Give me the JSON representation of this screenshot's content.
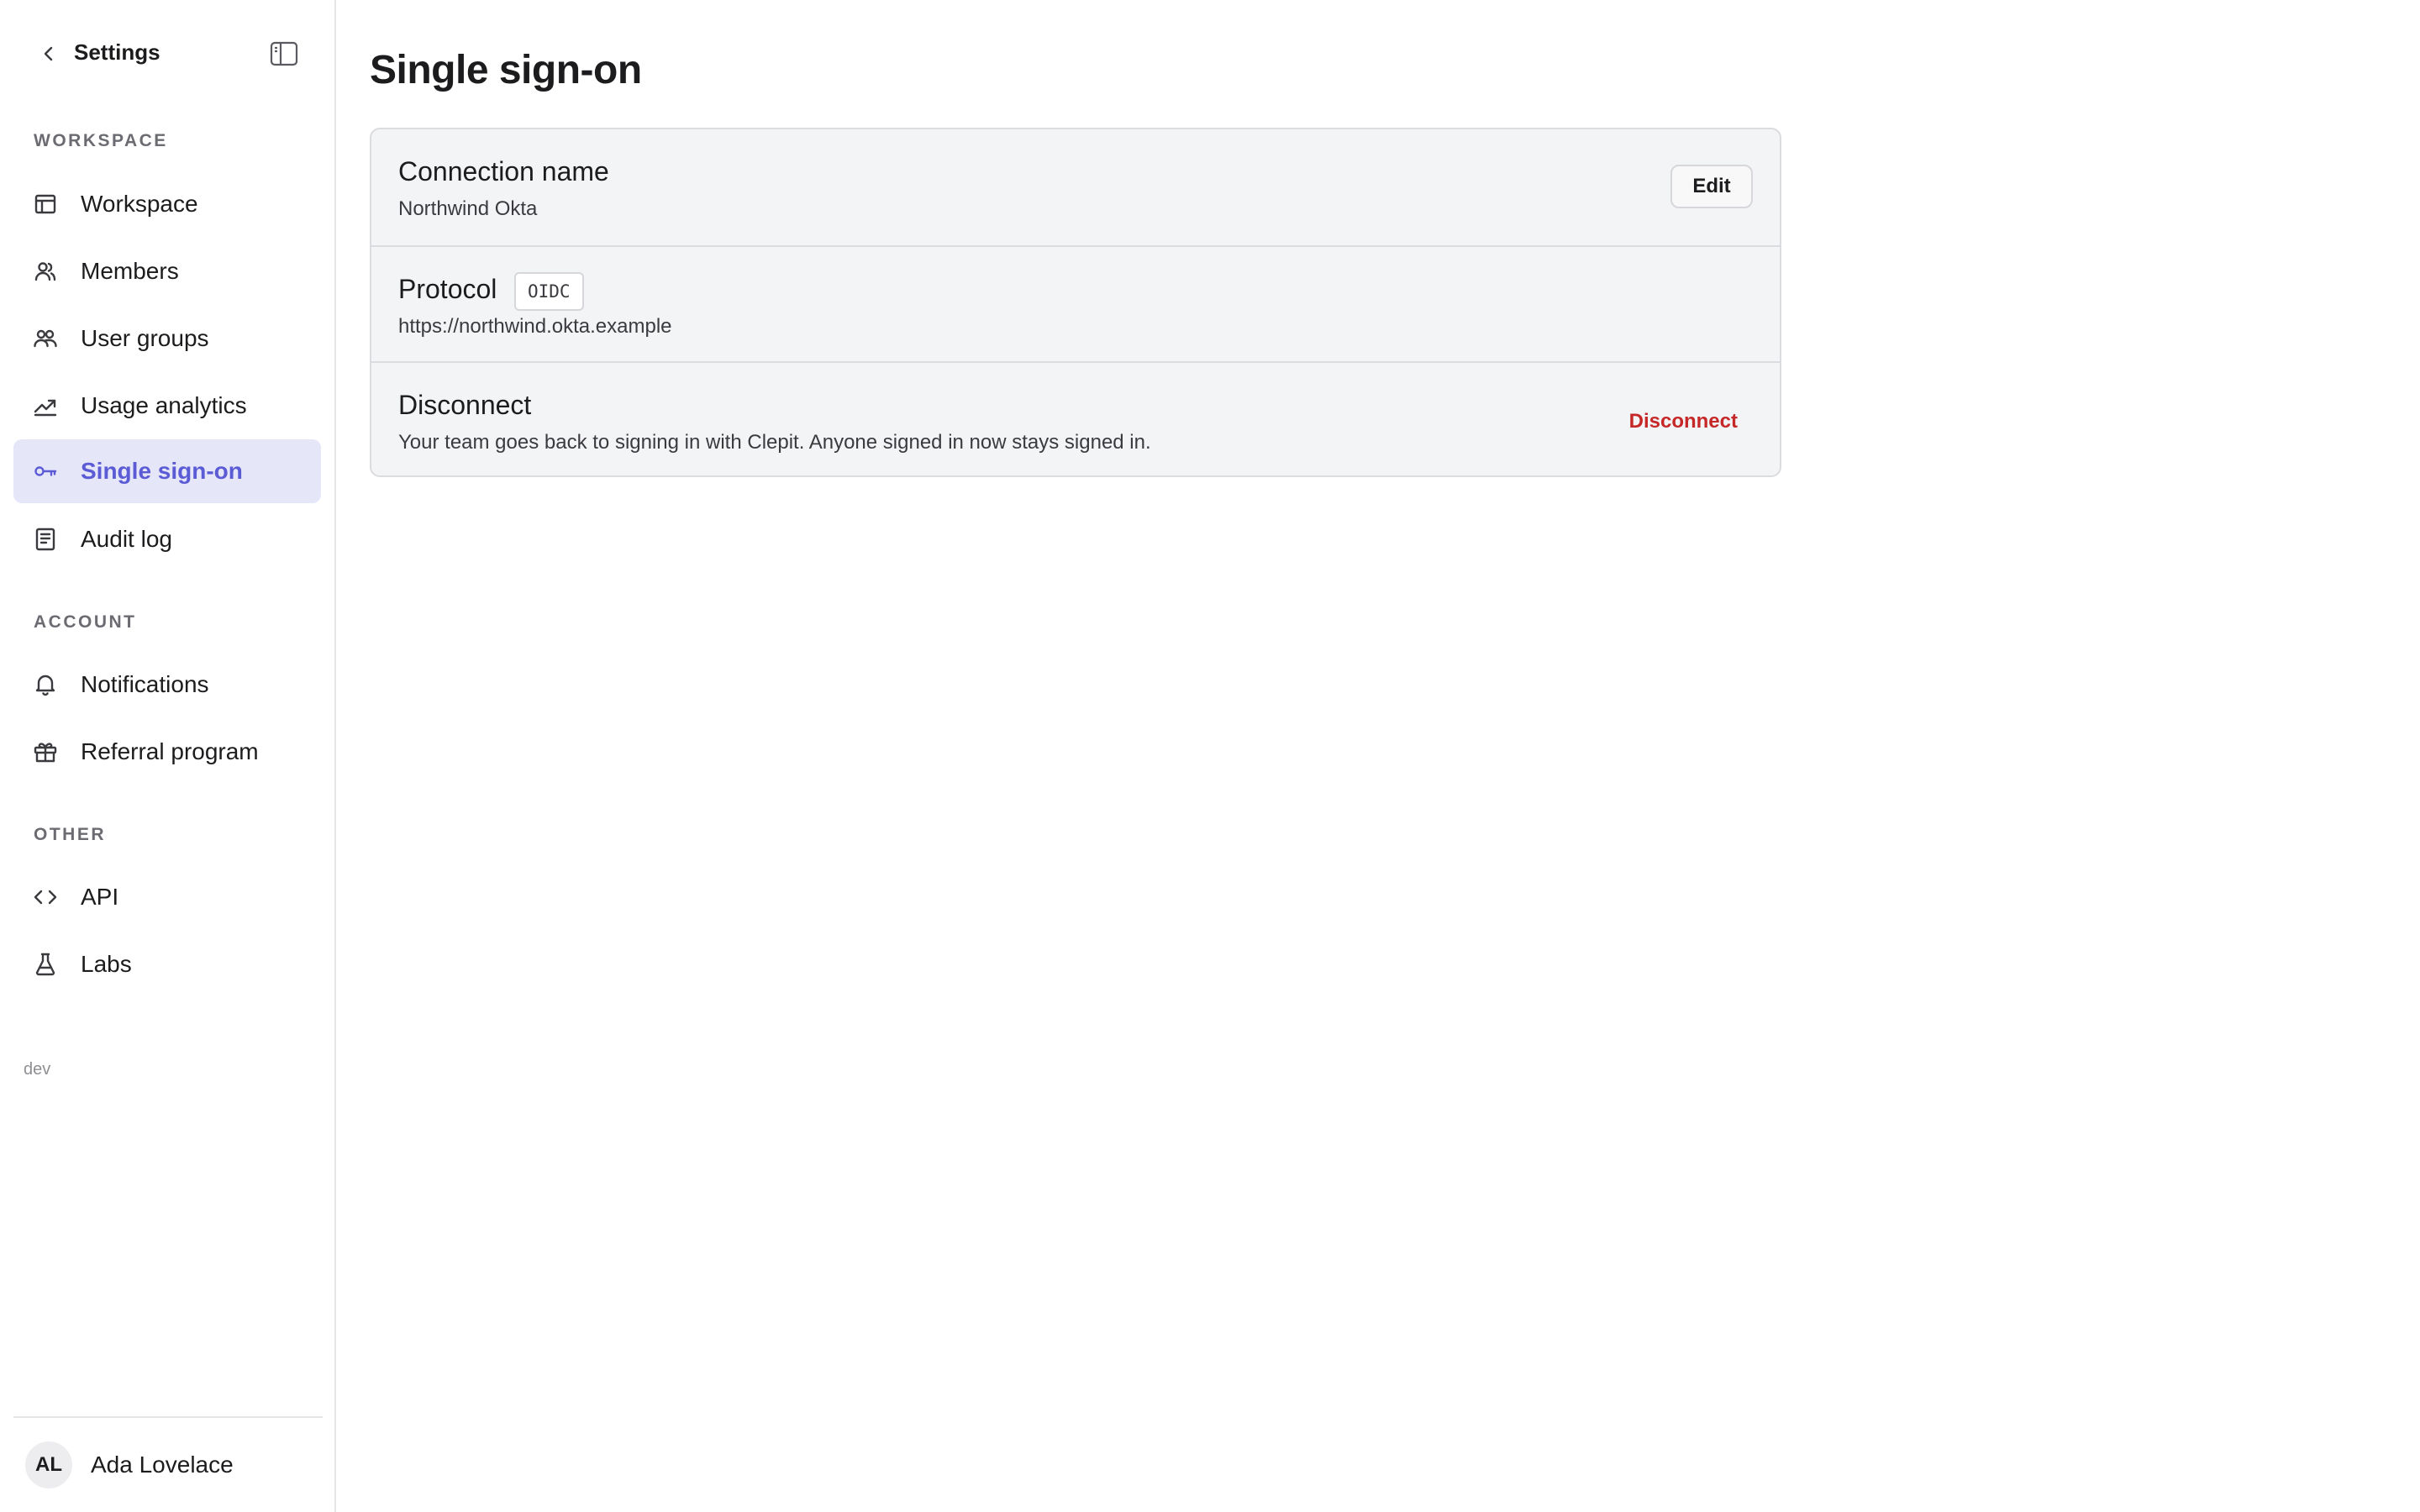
{
  "sidebar": {
    "back_icon": "chevron-left-icon",
    "title": "Settings",
    "panel_toggle_icon": "sidebar-panel-icon",
    "sections": [
      {
        "label": "WORKSPACE",
        "items": [
          {
            "label": "Workspace",
            "icon": "layout-icon"
          },
          {
            "label": "Members",
            "icon": "members-icon"
          },
          {
            "label": "User groups",
            "icon": "user-groups-icon"
          },
          {
            "label": "Usage analytics",
            "icon": "trend-up-icon"
          },
          {
            "label": "Single sign-on",
            "icon": "key-icon",
            "active": true
          },
          {
            "label": "Audit log",
            "icon": "document-icon"
          }
        ]
      },
      {
        "label": "ACCOUNT",
        "items": [
          {
            "label": "Notifications",
            "icon": "bell-icon"
          },
          {
            "label": "Referral program",
            "icon": "gift-icon"
          }
        ]
      },
      {
        "label": "OTHER",
        "items": [
          {
            "label": "API",
            "icon": "code-icon"
          },
          {
            "label": "Labs",
            "icon": "flask-icon"
          }
        ]
      }
    ],
    "env": "dev",
    "user": {
      "initials": "AL",
      "name": "Ada Lovelace"
    }
  },
  "main": {
    "title": "Single sign-on",
    "connection": {
      "title": "Connection name",
      "value": "Northwind Okta",
      "edit_label": "Edit"
    },
    "protocol": {
      "title": "Protocol",
      "badge": "OIDC",
      "url": "https://northwind.okta.example"
    },
    "disconnect": {
      "title": "Disconnect",
      "description": "Your team goes back to signing in with Clepit. Anyone signed in now stays signed in.",
      "button_label": "Disconnect"
    }
  },
  "colors": {
    "accent": "#5b5bd6",
    "active_bg": "#e6e6f9",
    "danger": "#c62828",
    "card_bg": "#f3f4f6",
    "border": "#dcdce0"
  }
}
